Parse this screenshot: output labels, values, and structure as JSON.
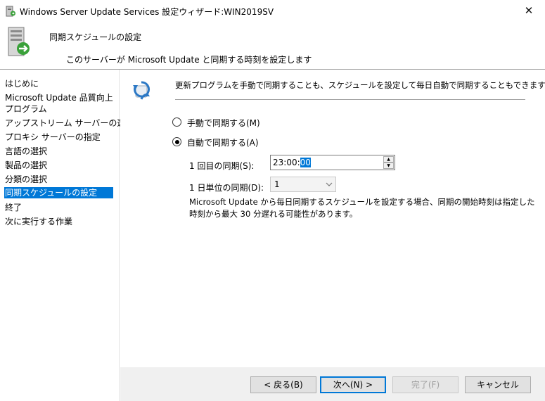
{
  "window": {
    "title": "Windows Server Update Services 設定ウィザード:WIN2019SV",
    "close_glyph": "✕"
  },
  "header": {
    "title": "同期スケジュールの設定",
    "subtitle": "このサーバーが Microsoft Update と同期する時刻を設定します"
  },
  "sidebar": {
    "items": [
      {
        "label": "はじめに"
      },
      {
        "label": "Microsoft Update 品質向上"
      },
      {
        "label": "プログラム"
      },
      {
        "label": "アップストリーム サーバーの選択"
      },
      {
        "label": "プロキシ サーバーの指定"
      },
      {
        "label": "言語の選択"
      },
      {
        "label": "製品の選択"
      },
      {
        "label": "分類の選択"
      },
      {
        "label": "同期スケジュールの設定",
        "selected": true
      },
      {
        "label": "終了"
      },
      {
        "label": "次に実行する作業"
      }
    ]
  },
  "main": {
    "intro": "更新プログラムを手動で同期することも、スケジュールを設定して毎日自動で同期することもできます。",
    "radio_manual": {
      "label": "手動で同期する(M)",
      "checked": false
    },
    "radio_auto": {
      "label": "自動で同期する(A)",
      "checked": true
    },
    "first_sync": {
      "label": "1 回目の同期(S):",
      "value_hm": "23:00:",
      "value_sec": "00"
    },
    "daily_sync": {
      "label": "1 日単位の同期(D):",
      "value": "1"
    },
    "note": "Microsoft Update から毎日同期するスケジュールを設定する場合、同期の開始時刻は指定した時刻から最大 30 分遅れる可能性があります。"
  },
  "buttons": {
    "back": "< 戻る(B)",
    "next": "次へ(N) >",
    "finish": "完了(F)",
    "cancel": "キャンセル"
  },
  "colors": {
    "accent": "#0078d7",
    "footer": "#f0f0f0"
  },
  "icons": {
    "title": "wsus-window-icon",
    "header": "server-sync-icon",
    "sync": "sync-icon",
    "dropdown": "chevron-down-icon"
  }
}
